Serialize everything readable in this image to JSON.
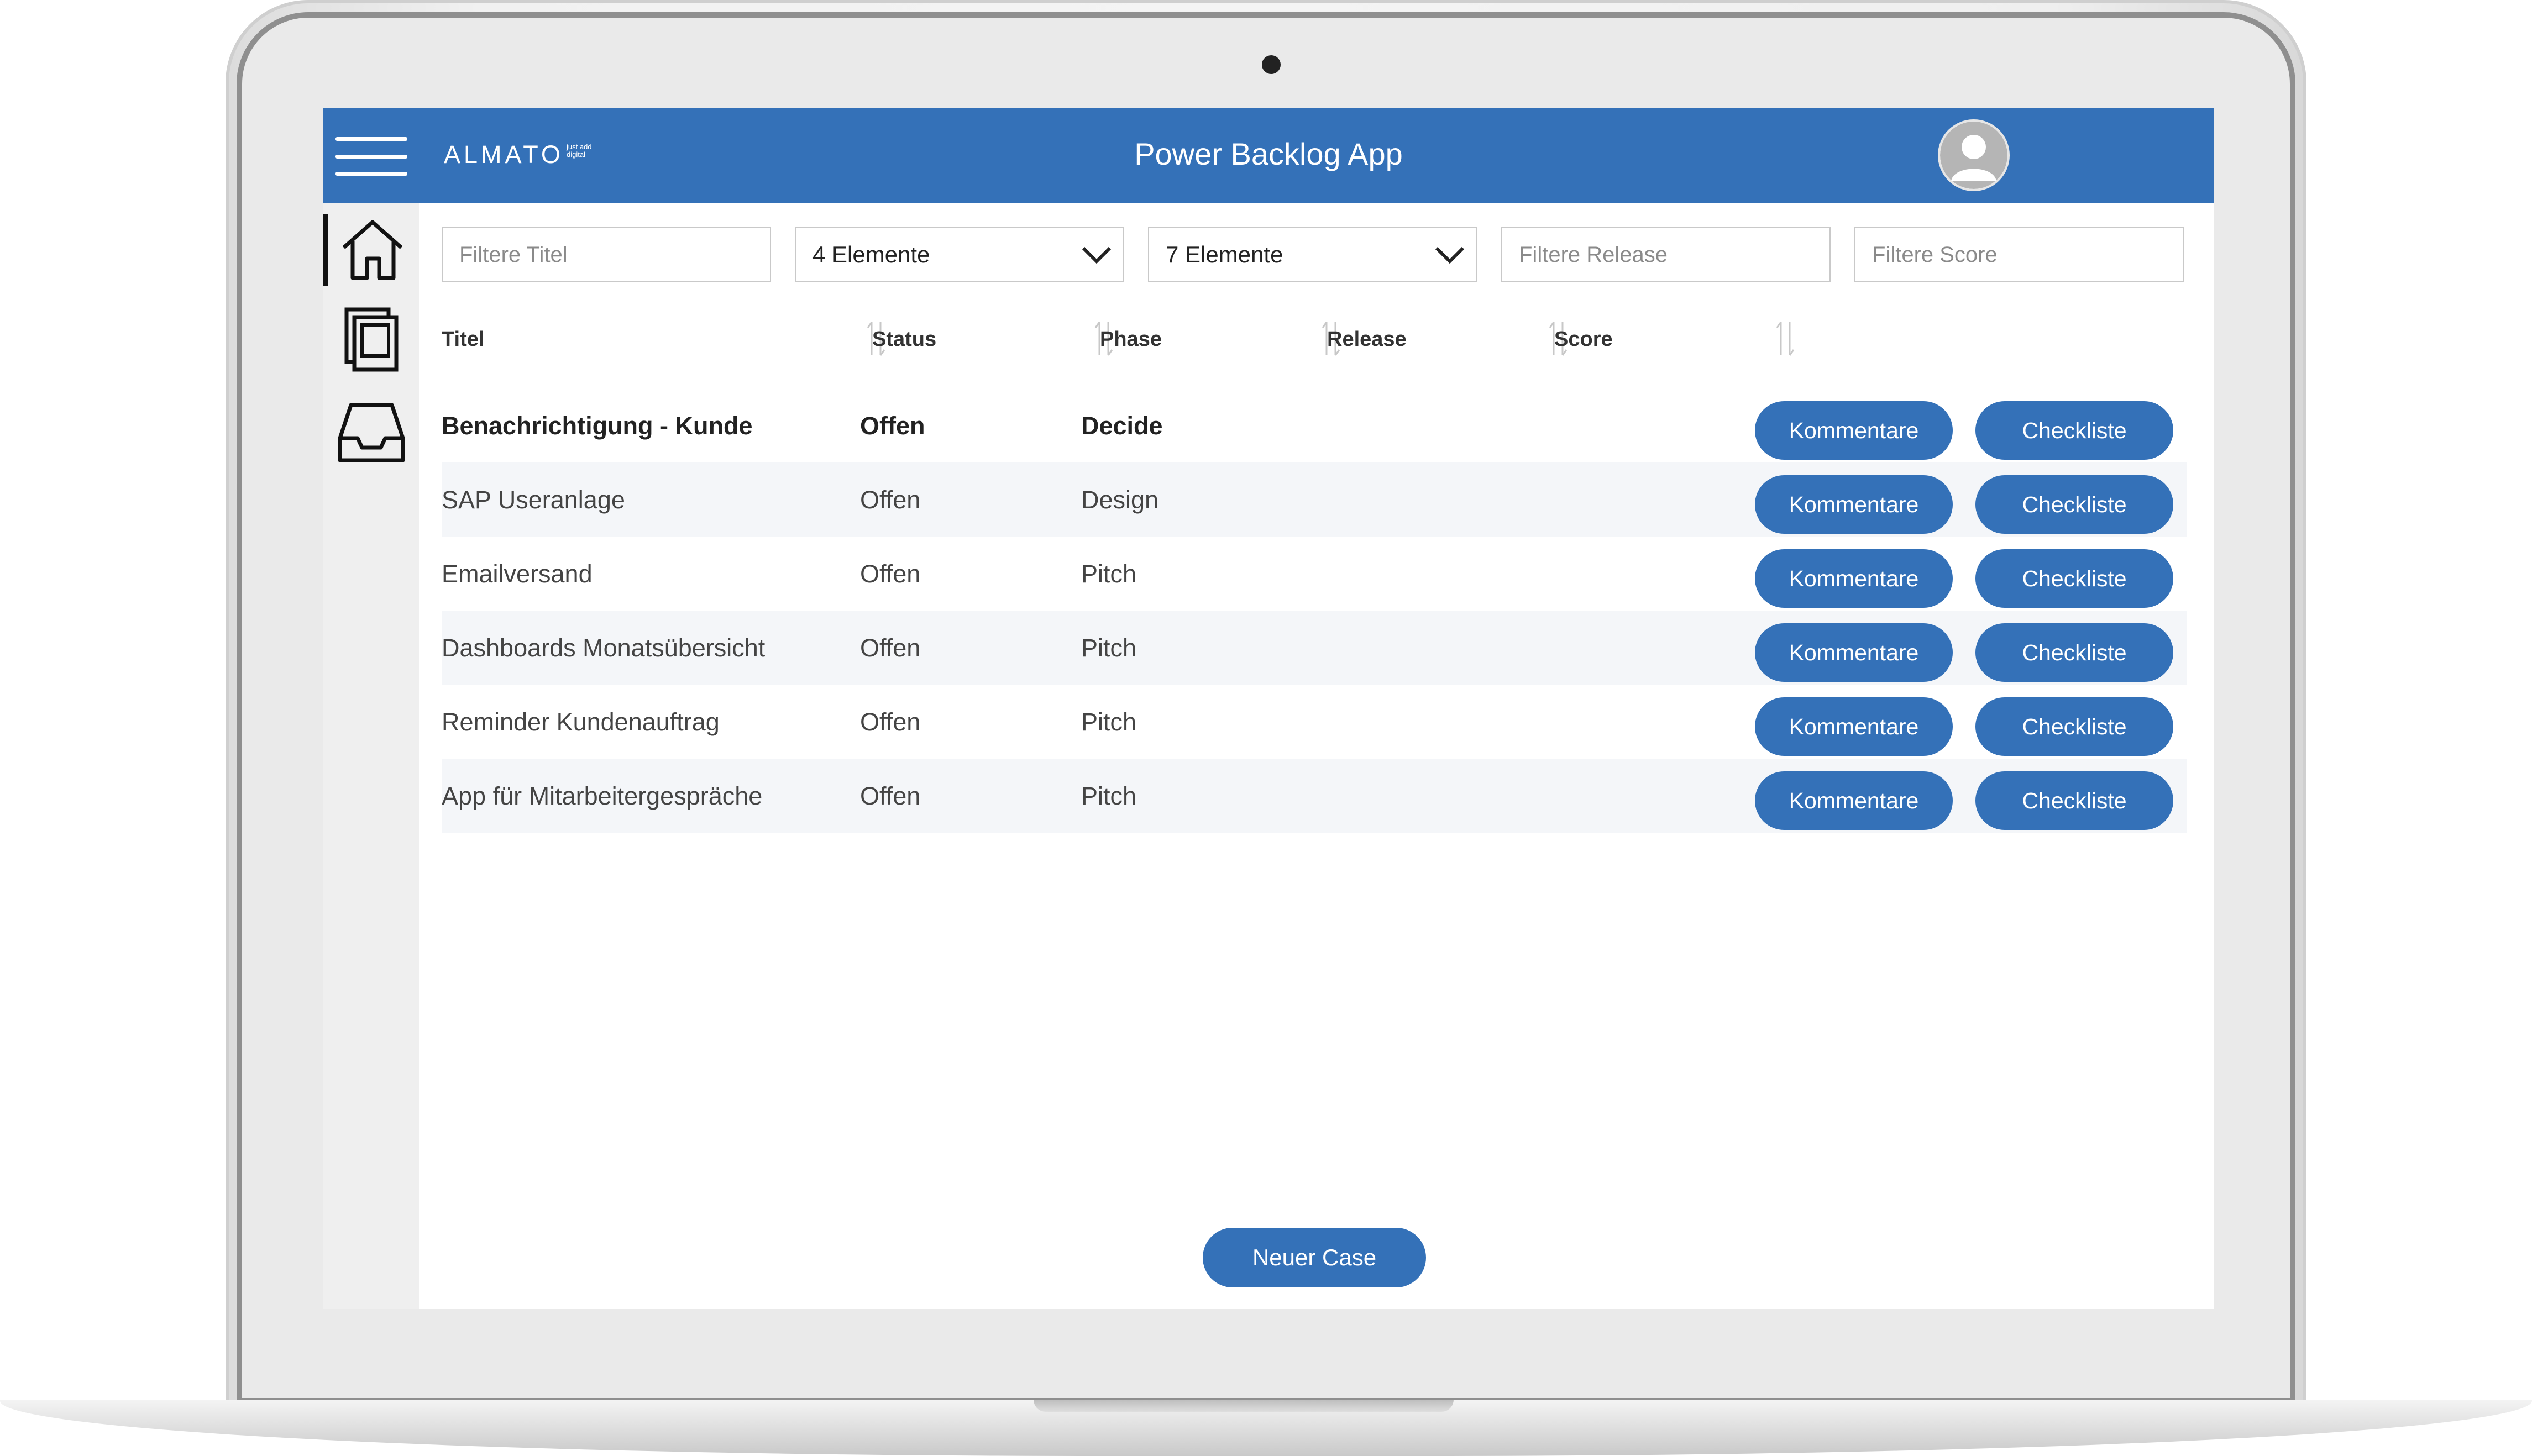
{
  "header": {
    "app_title": "Power Backlog App",
    "logo_text": "ALMATO",
    "logo_tagline": "just add digital"
  },
  "sidebar": {
    "items": [
      {
        "name": "home",
        "icon": "home-icon"
      },
      {
        "name": "stack",
        "icon": "stacked-pages-icon"
      },
      {
        "name": "inbox",
        "icon": "inbox-tray-icon"
      }
    ]
  },
  "filters": {
    "title_placeholder": "Filtere Titel",
    "status_value": "4 Elemente",
    "phase_value": "7 Elemente",
    "release_placeholder": "Filtere Release",
    "score_placeholder": "Filtere Score"
  },
  "table": {
    "columns": [
      "Titel",
      "Status",
      "Phase",
      "Release",
      "Score"
    ],
    "rows": [
      {
        "titel": "Benachrichtigung - Kunde",
        "status": "Offen",
        "phase": "Decide"
      },
      {
        "titel": "SAP Useranlage",
        "status": "Offen",
        "phase": "Design"
      },
      {
        "titel": "Emailversand",
        "status": "Offen",
        "phase": "Pitch"
      },
      {
        "titel": "Dashboards Monatsübersicht",
        "status": "Offen",
        "phase": "Pitch"
      },
      {
        "titel": "Reminder Kundenauftrag",
        "status": "Offen",
        "phase": "Pitch"
      },
      {
        "titel": "App für Mitarbeitergespräche",
        "status": "Offen",
        "phase": "Pitch"
      }
    ],
    "button_comments": "Kommentare",
    "button_checklist": "Checkliste"
  },
  "new_case_label": "Neuer Case",
  "colors": {
    "accent": "#3471b8",
    "sidebar_bg": "#efefef",
    "row_alt": "#f4f6f9"
  }
}
